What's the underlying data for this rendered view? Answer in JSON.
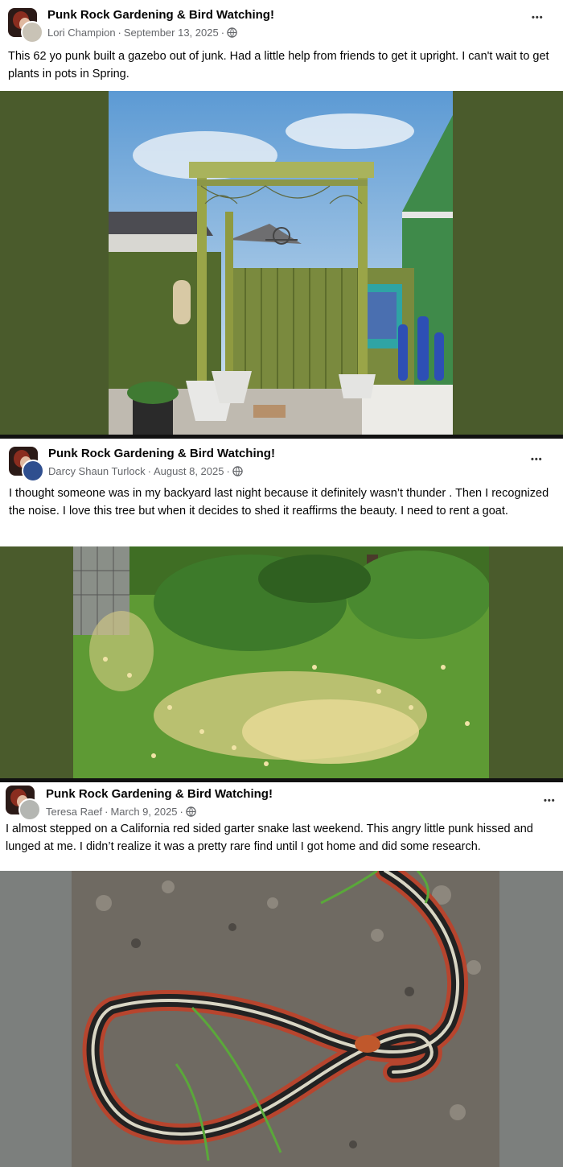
{
  "posts": [
    {
      "group": "Punk Rock Gardening & Bird Watching!",
      "author": "Lori Champion",
      "date": "September 13, 2025",
      "text": "This 62 yo punk built a gazebo out of junk. Had a little help from friends to get it upright. I can't wait to get plants in pots in Spring.",
      "more_label": "•••"
    },
    {
      "group": "Punk Rock Gardening & Bird Watching!",
      "author": "Darcy Shaun Turlock",
      "date": "August 8, 2025",
      "text": "I thought someone was in my backyard last night because it definitely wasn’t thunder . Then I recognized the noise. I love this tree but when it decides to shed it reaffirms the beauty. I need to rent a goat.",
      "more_label": "•••"
    },
    {
      "group": "Punk Rock Gardening & Bird Watching!",
      "author": "Teresa Raef",
      "date": "March 9, 2025",
      "text": "I almost stepped on a California red sided garter snake last weekend. This angry little punk hissed and lunged at me. I didn’t realize it was a pretty rare find until I got home and did some research.",
      "more_label": "•••"
    }
  ],
  "separator": "·",
  "colors": {
    "olive_backdrop": "#4a5b2c",
    "gray_backdrop": "#7c7f7d",
    "meta_text": "#65676b"
  }
}
